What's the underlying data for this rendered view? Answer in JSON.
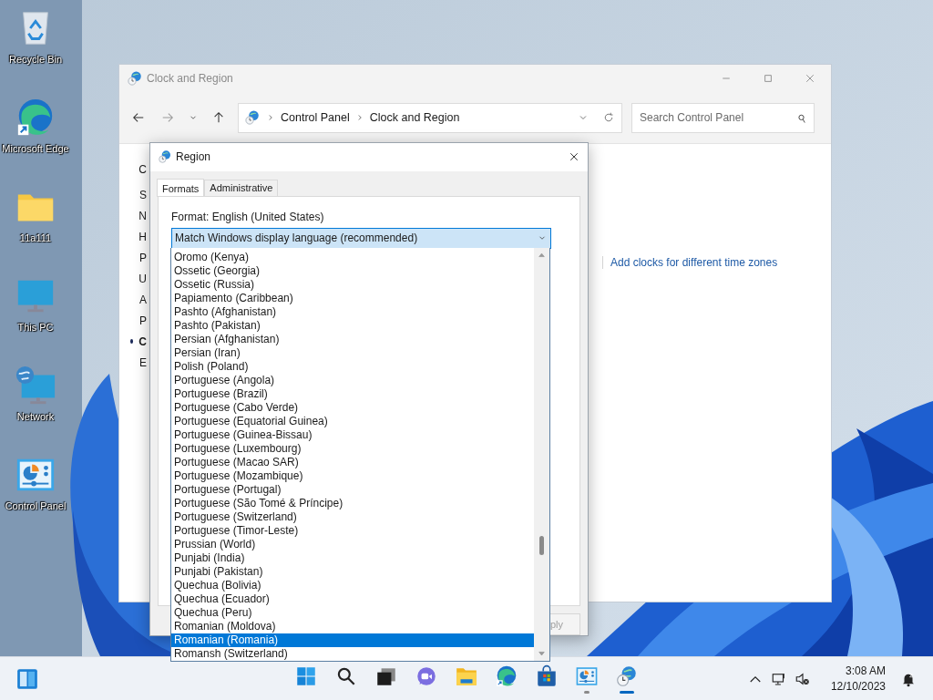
{
  "desktop_icons": [
    {
      "label": "Recycle Bin",
      "kind": "recycle"
    },
    {
      "label": "Microsoft Edge",
      "kind": "edge"
    },
    {
      "label": "11a111",
      "kind": "folder"
    },
    {
      "label": "This PC",
      "kind": "pc"
    },
    {
      "label": "Network",
      "kind": "network"
    },
    {
      "label": "Control Panel",
      "kind": "control"
    }
  ],
  "explorer": {
    "title": "Clock and Region",
    "breadcrumb": [
      "Control Panel",
      "Clock and Region"
    ],
    "search": {
      "placeholder": "Search Control Panel"
    },
    "side_links": [
      {
        "label": "C",
        "current": false
      },
      {
        "label": "S",
        "current": false
      },
      {
        "label": "N",
        "current": false
      },
      {
        "label": "H",
        "current": false
      },
      {
        "label": "P",
        "current": false
      },
      {
        "label": "U",
        "current": false
      },
      {
        "label": "A",
        "current": false
      },
      {
        "label": "P",
        "current": false
      },
      {
        "label": "C",
        "current": true
      },
      {
        "label": "E",
        "current": false
      }
    ],
    "link": "Add clocks for different time zones"
  },
  "dialog": {
    "title": "Region",
    "tabs": [
      {
        "label": "Formats",
        "selected": true
      },
      {
        "label": "Administrative",
        "selected": false
      }
    ],
    "format_label": "Format: English (United States)",
    "combo": {
      "value": "Match Windows display language (recommended)"
    },
    "options": [
      {
        "label": "Oromo (Kenya)",
        "selected": false
      },
      {
        "label": "Ossetic (Georgia)",
        "selected": false
      },
      {
        "label": "Ossetic (Russia)",
        "selected": false
      },
      {
        "label": "Papiamento (Caribbean)",
        "selected": false
      },
      {
        "label": "Pashto (Afghanistan)",
        "selected": false
      },
      {
        "label": "Pashto (Pakistan)",
        "selected": false
      },
      {
        "label": "Persian (Afghanistan)",
        "selected": false
      },
      {
        "label": "Persian (Iran)",
        "selected": false
      },
      {
        "label": "Polish (Poland)",
        "selected": false
      },
      {
        "label": "Portuguese (Angola)",
        "selected": false
      },
      {
        "label": "Portuguese (Brazil)",
        "selected": false
      },
      {
        "label": "Portuguese (Cabo Verde)",
        "selected": false
      },
      {
        "label": "Portuguese (Equatorial Guinea)",
        "selected": false
      },
      {
        "label": "Portuguese (Guinea-Bissau)",
        "selected": false
      },
      {
        "label": "Portuguese (Luxembourg)",
        "selected": false
      },
      {
        "label": "Portuguese (Macao SAR)",
        "selected": false
      },
      {
        "label": "Portuguese (Mozambique)",
        "selected": false
      },
      {
        "label": "Portuguese (Portugal)",
        "selected": false
      },
      {
        "label": "Portuguese (São Tomé & Príncipe)",
        "selected": false
      },
      {
        "label": "Portuguese (Switzerland)",
        "selected": false
      },
      {
        "label": "Portuguese (Timor-Leste)",
        "selected": false
      },
      {
        "label": "Prussian (World)",
        "selected": false
      },
      {
        "label": "Punjabi (India)",
        "selected": false
      },
      {
        "label": "Punjabi (Pakistan)",
        "selected": false
      },
      {
        "label": "Quechua (Bolivia)",
        "selected": false
      },
      {
        "label": "Quechua (Ecuador)",
        "selected": false
      },
      {
        "label": "Quechua (Peru)",
        "selected": false
      },
      {
        "label": "Romanian (Moldova)",
        "selected": false
      },
      {
        "label": "Romanian (Romania)",
        "selected": true
      },
      {
        "label": "Romansh (Switzerland)",
        "selected": false
      }
    ],
    "apply_button": "ply"
  },
  "taskbar": {
    "apps": [
      {
        "kind": "start",
        "running": false,
        "active": false
      },
      {
        "kind": "search",
        "running": false,
        "active": false
      },
      {
        "kind": "taskview",
        "running": false,
        "active": false
      },
      {
        "kind": "chat",
        "running": false,
        "active": false
      },
      {
        "kind": "explorer",
        "running": false,
        "active": false
      },
      {
        "kind": "edge",
        "running": false,
        "active": false
      },
      {
        "kind": "store",
        "running": false,
        "active": false
      },
      {
        "kind": "control",
        "running": true,
        "active": false
      },
      {
        "kind": "clock",
        "running": true,
        "active": true
      }
    ],
    "time": "3:08 AM",
    "date": "12/10/2023"
  }
}
